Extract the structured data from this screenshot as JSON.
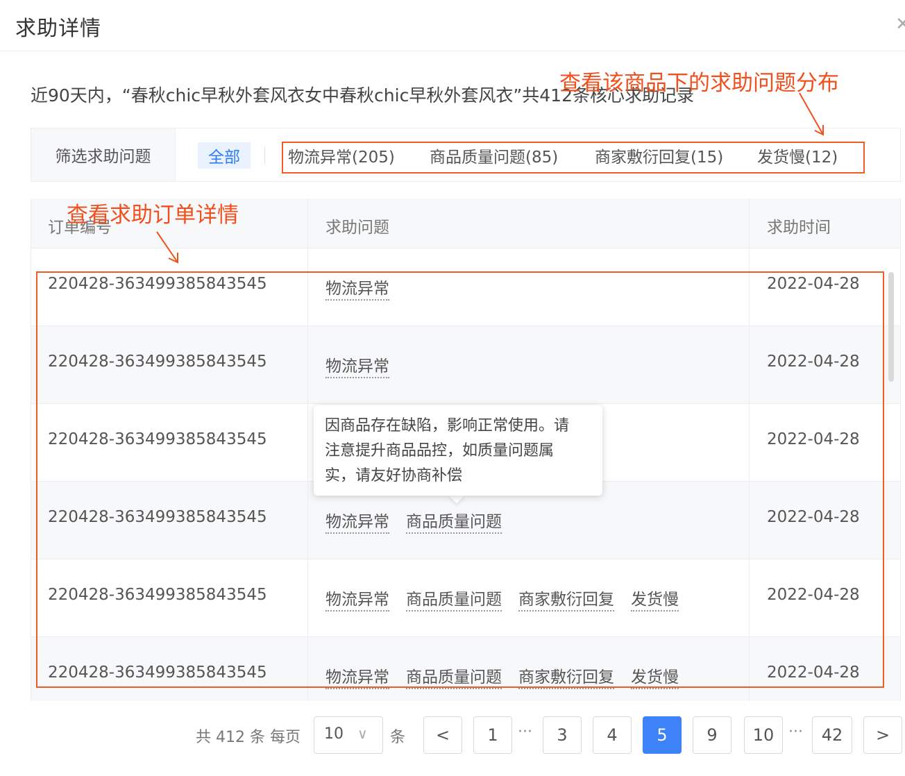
{
  "dialog": {
    "title": "求助详情",
    "close_icon": "close-icon"
  },
  "summary": "近90天内，“春秋chic早秋外套风衣女中春秋chic早秋外套风衣”共412条核心求助记录",
  "filter": {
    "label": "筛选求助问题",
    "all": "全部",
    "options": [
      "物流异常(205)",
      "商品质量问题(85)",
      "商家敷衍回复(15)",
      "发货慢(12)"
    ]
  },
  "table": {
    "headers": {
      "order": "订单编号",
      "issue": "求助问题",
      "time": "求助时间"
    },
    "rows": [
      {
        "order": "220428-363499385843545",
        "tags": [
          "物流异常"
        ],
        "time": "2022-04-28"
      },
      {
        "order": "220428-363499385843545",
        "tags": [
          "物流异常"
        ],
        "time": "2022-04-28"
      },
      {
        "order": "220428-363499385843545",
        "tags": [],
        "time": "2022-04-28"
      },
      {
        "order": "220428-363499385843545",
        "tags": [
          "物流异常",
          "商品质量问题"
        ],
        "time": "2022-04-28"
      },
      {
        "order": "220428-363499385843545",
        "tags": [
          "物流异常",
          "商品质量问题",
          "商家敷衍回复",
          "发货慢"
        ],
        "time": "2022-04-28"
      },
      {
        "order": "220428-363499385843545",
        "tags": [
          "物流异常",
          "商品质量问题",
          "商家敷衍回复",
          "发货慢"
        ],
        "time": "2022-04-28"
      }
    ]
  },
  "tooltip": {
    "lines": [
      "因商品存在缺陷，影响正常使用。请",
      "注意提升商品品控，如质量问题属",
      "实，请友好协商补偿"
    ]
  },
  "annotations": {
    "filter_note": "查看该商品下的求助问题分布",
    "table_note": "查看求助订单详情",
    "color": "#f0501d"
  },
  "pagination": {
    "total_text": "共 412 条 每页",
    "page_size": "10",
    "unit": "条",
    "prev": "<",
    "next": ">",
    "pages": [
      "1",
      "3",
      "4",
      "5",
      "9",
      "10",
      "42"
    ],
    "ellipsis": "···",
    "current": "5"
  }
}
